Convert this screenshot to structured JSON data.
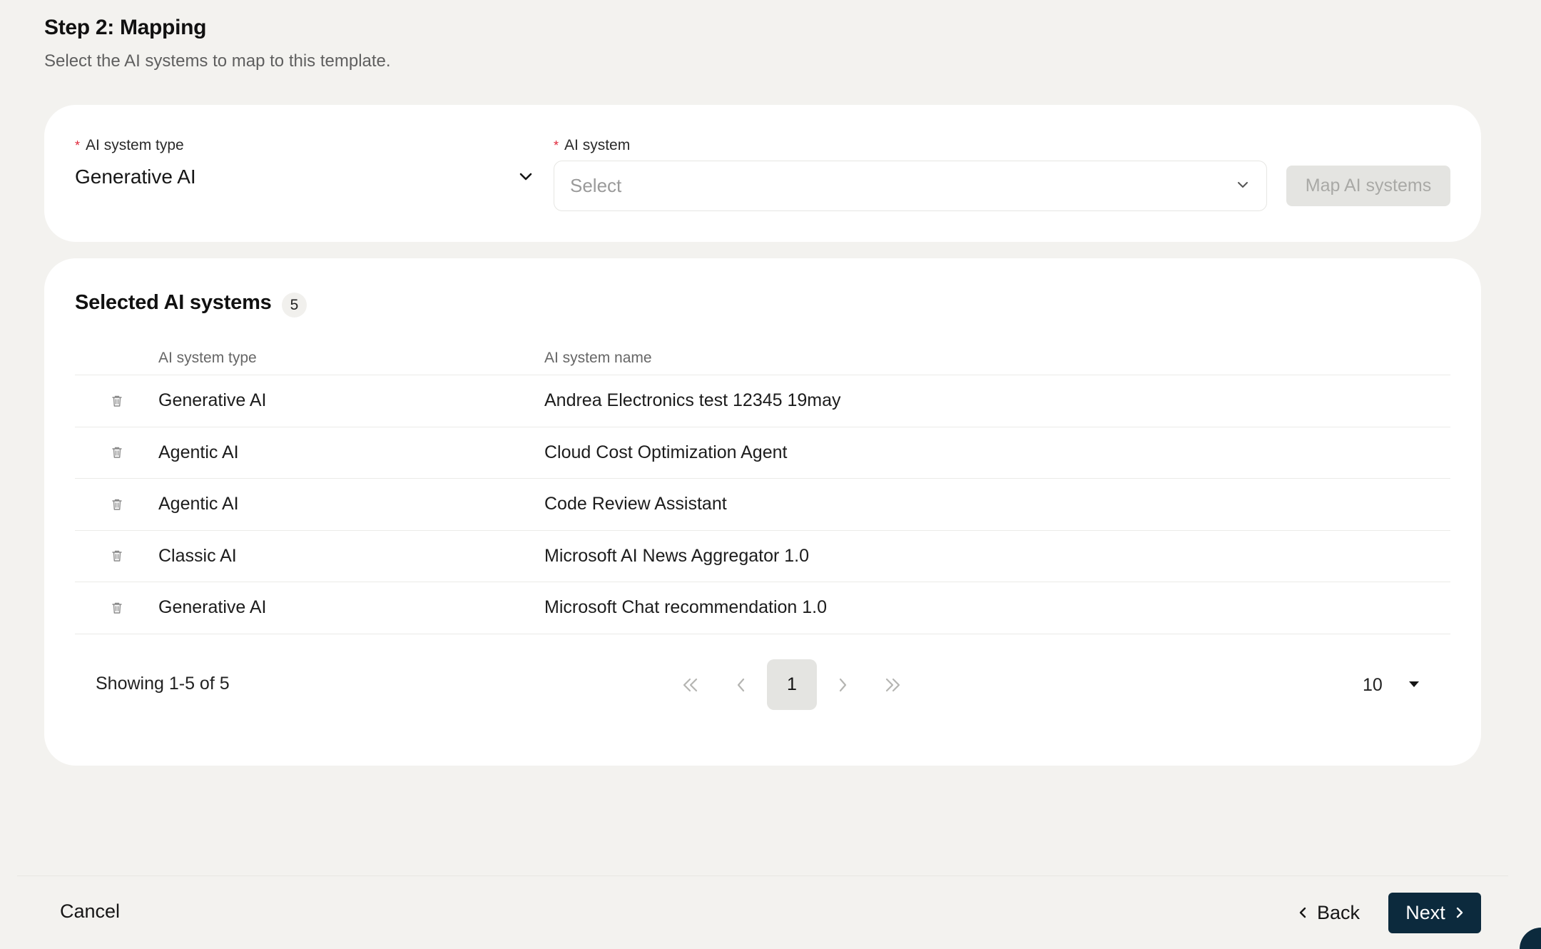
{
  "header": {
    "title": "Step 2: Mapping",
    "subtitle": "Select the AI systems to map to this template."
  },
  "form": {
    "type_label": "AI system type",
    "type_value": "Generative AI",
    "system_label": "AI system",
    "system_placeholder": "Select",
    "map_button": "Map AI systems",
    "required_mark": "*"
  },
  "selected": {
    "title": "Selected AI systems",
    "count": "5",
    "columns": [
      "AI system type",
      "AI system name"
    ],
    "rows": [
      {
        "type": "Generative AI",
        "name": "Andrea Electronics test 12345 19may"
      },
      {
        "type": "Agentic AI",
        "name": "Cloud Cost Optimization Agent"
      },
      {
        "type": "Agentic AI",
        "name": "Code Review Assistant"
      },
      {
        "type": "Classic AI",
        "name": "Microsoft AI News Aggregator 1.0"
      },
      {
        "type": "Generative AI",
        "name": "Microsoft Chat recommendation 1.0"
      }
    ]
  },
  "pagination": {
    "showing": "Showing 1-5 of 5",
    "current_page": "1",
    "page_size": "10"
  },
  "footer": {
    "cancel": "Cancel",
    "back": "Back",
    "next": "Next"
  },
  "colors": {
    "background": "#f3f2ef",
    "card": "#ffffff",
    "primary": "#0c2a3d",
    "required": "#e0283a",
    "disabled_bg": "#e4e4e1"
  }
}
